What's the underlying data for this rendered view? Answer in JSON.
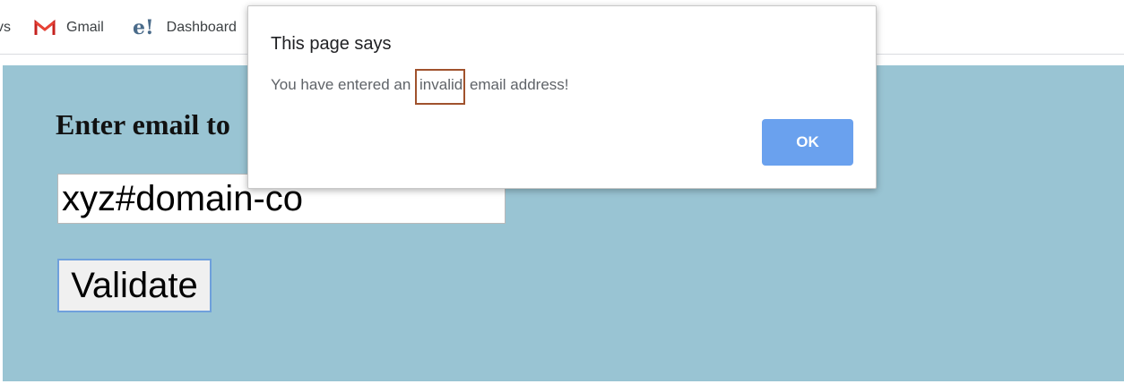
{
  "bookmarks": {
    "partial_label": "vs",
    "items": [
      {
        "label": "Gmail",
        "icon": "gmail-icon"
      },
      {
        "label": "Dashboard",
        "icon": "e-icon"
      }
    ]
  },
  "page": {
    "heading": "Enter email to",
    "email_value": "xyz#domain-co",
    "validate_label": "Validate",
    "background_color": "#99c4d3"
  },
  "dialog": {
    "title": "This page says",
    "message_before": "You have entered an ",
    "message_highlight": "invalid",
    "message_after": " email address!",
    "ok_label": "OK",
    "ok_color": "#6aa1ee",
    "highlight_color": "#a0522d"
  }
}
